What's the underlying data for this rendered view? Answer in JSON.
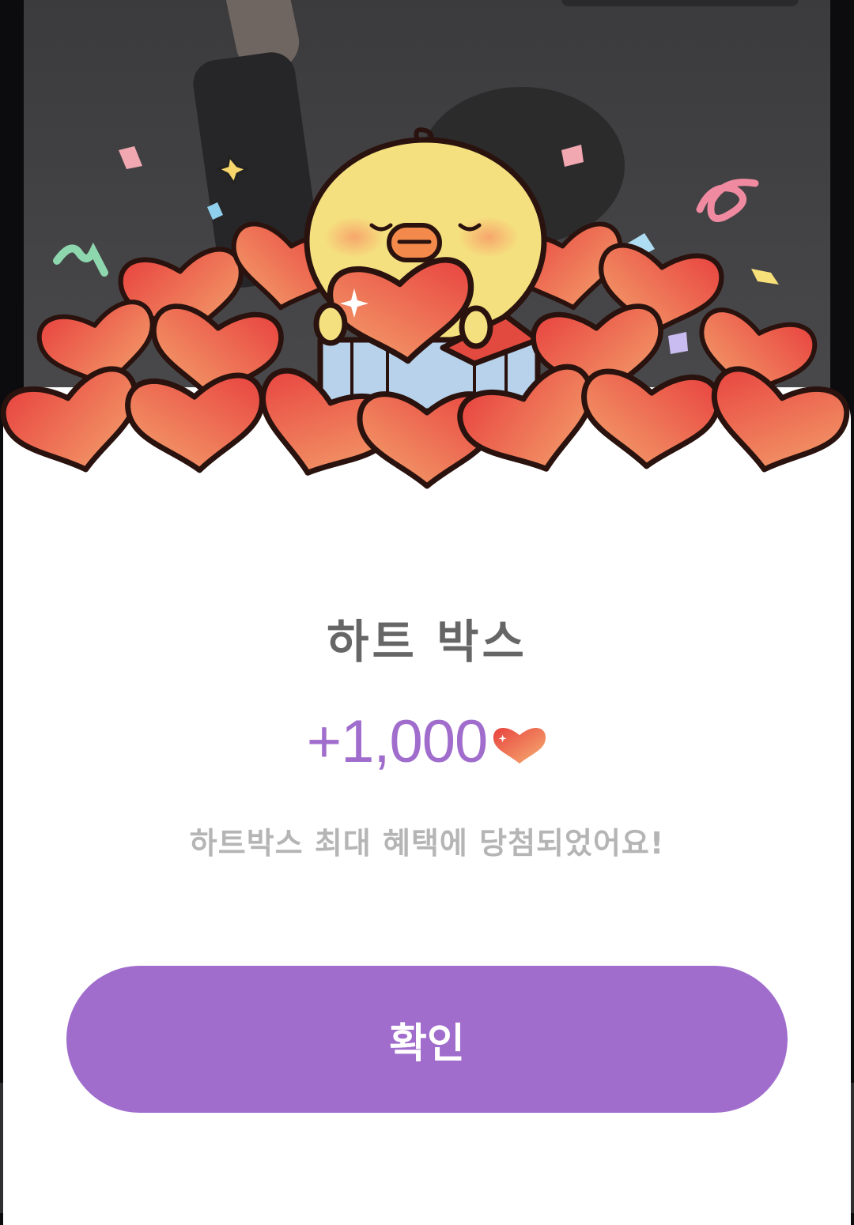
{
  "dialog": {
    "title": "하트 박스",
    "amount": "+1,000",
    "message": "하트박스 최대 혜택에 당첨되었어요!",
    "confirm_label": "확인"
  },
  "icons": {
    "reward": "heart-icon",
    "mascot": "chick-mascot-icon"
  },
  "colors": {
    "accent": "#a06dcd",
    "heart": "#ef6a4e",
    "title": "#666666",
    "subtitle": "#b5b5b5"
  }
}
